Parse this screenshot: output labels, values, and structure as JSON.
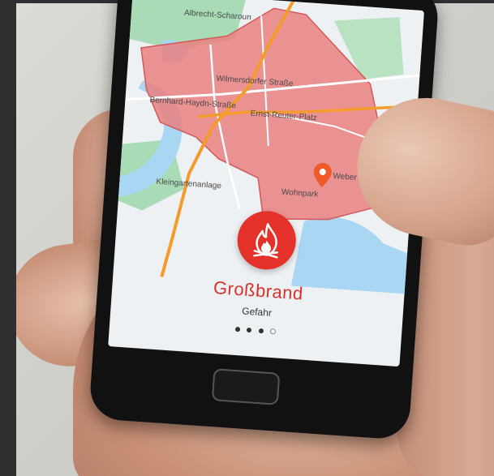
{
  "map": {
    "labels": [
      {
        "id": "label-1",
        "text": "Albrecht-Scharoun"
      },
      {
        "id": "label-2",
        "text": "Kleingartenanlage"
      },
      {
        "id": "label-3",
        "text": "Wilmersdorfer Straße"
      },
      {
        "id": "label-4",
        "text": "Bernhard-Haydn-Straße"
      },
      {
        "id": "label-5",
        "text": "Weber Weg"
      },
      {
        "id": "label-6",
        "text": "Wohnpark"
      },
      {
        "id": "label-7",
        "text": "Ernst-Reuter-Platz"
      }
    ],
    "colors": {
      "zone": "#e98080",
      "water": "#a9d6f2",
      "green": "#a8dbb6",
      "road": "#f59b2c",
      "pin": "#f05a28"
    }
  },
  "alert": {
    "icon": "fire-icon",
    "title": "Großbrand",
    "subtitle": "Gefahr",
    "page_count": 4,
    "active_index": 0,
    "color": "#e4312a"
  },
  "device": {
    "home_button_icon": "home-button"
  }
}
